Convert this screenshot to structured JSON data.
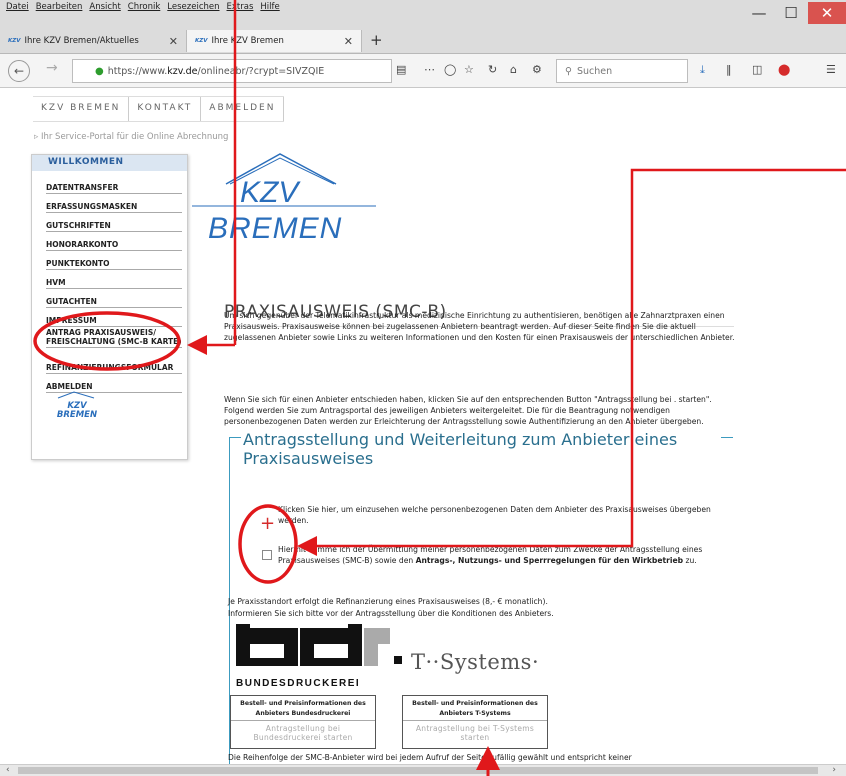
{
  "browser": {
    "menu": [
      "Datei",
      "Bearbeiten",
      "Ansicht",
      "Chronik",
      "Lesezeichen",
      "Extras",
      "Hilfe"
    ],
    "tabs": [
      {
        "favicon": "KZV",
        "title": "Ihre KZV Bremen/Aktuelles"
      },
      {
        "favicon": "KZV",
        "title": "Ihre KZV Bremen"
      }
    ],
    "url_prefix": "https://www.",
    "url_host": "kzv.de",
    "url_path": "/onlineabr/?crypt=SIVZQIE",
    "search_placeholder": "Suchen",
    "icons": [
      "back-icon",
      "forward-icon",
      "info-icon",
      "lock-icon",
      "reader-icon",
      "more-icon",
      "pocket-icon",
      "bookmark-star-icon",
      "reload-icon",
      "home-icon",
      "addon-icon",
      "search-icon",
      "download-icon",
      "library-icon",
      "sidebar-icon",
      "adblock-icon",
      "menu-icon"
    ]
  },
  "site": {
    "topnav": [
      "KZV BREMEN",
      "KONTAKT",
      "ABMELDEN"
    ],
    "breadcrumb": "Ihr Service-Portal für die Online Abrechnung",
    "logo_top": "KZV",
    "logo_bottom": "BREMEN"
  },
  "sidebar": {
    "heading": "WILLKOMMEN",
    "items": [
      {
        "label": "DATENTRANSFER"
      },
      {
        "label": "ERFASSUNGSMASKEN"
      },
      {
        "label": "GUTSCHRIFTEN"
      },
      {
        "label": "HONORARKONTO"
      },
      {
        "label": "PUNKTEKONTO"
      },
      {
        "label": "HVM"
      },
      {
        "label": "GUTACHTEN"
      },
      {
        "label": "IMPRESSUM"
      },
      {
        "label": "ANTRAG PRAXISAUSWEIS/ FREISCHALTUNG (SMC-B KARTE)"
      },
      {
        "label": "REFINANZIERUNGSFORMULAR"
      },
      {
        "label": "ABMELDEN"
      }
    ],
    "logo_top": "KZV",
    "logo_bottom": "BREMEN"
  },
  "main": {
    "title": "PRAXISAUSWEIS (SMC-B)",
    "para1": "Um sich gegenüber der Telematikinfrastruktur als medizinische Einrichtung zu authentisieren, benötigen alle Zahnarztpraxen einen Praxisausweis. Praxisausweise können bei zugelassenen Anbietern beantragt werden. Auf dieser Seite finden Sie die aktuell zugelassenen Anbieter sowie Links zu weiteren Informationen und den Kosten für einen Praxisausweis der unterschiedlichen Anbieter.",
    "para2": "Wenn Sie sich für einen Anbieter entschieden haben, klicken Sie auf den entsprechenden Button \"Antragsstellung bei . starten\". Folgend werden Sie zum Antragsportal des jeweiligen Anbieters weitergeleitet. Die für die Beantragung notwendigen personenbezogenen Daten werden zur Erleichterung der Antragsstellung sowie Authentifizierung an den Anbieter übergeben.",
    "box_title": "Antragsstellung und Weiterleitung zum Anbieter eines Praxisausweises",
    "expand_text": "Klicken Sie hier, um einzusehen welche personenbezogenen Daten dem Anbieter des Praxisausweises übergeben werden.",
    "consent_text": "Hiermit stimme ich der Übermittlung meiner personenbezogenen Daten zum Zwecke der Antragsstellung eines Praxisausweises (SMC-B) sowie den",
    "consent_bold": "Antrags-, Nutzungs- und Sperrregelungen für den Wirkbetrieb",
    "consent_end": "zu.",
    "refi_line1": "Je Praxisstandort erfolgt die Refinanzierung eines Praxisausweises (8,- € monatlich).",
    "refi_line2": "Informieren Sie sich bitte vor der Antragsstellung über die Konditionen des Anbieters.",
    "providers": [
      {
        "logo_text": "BUNDESDRUCKEREI",
        "info": "Bestell- und Preisinformationen des Anbieters Bundesdruckerei",
        "start": "Antragstellung bei Bundesdruckerei starten"
      },
      {
        "logo_text": "T··Systems·",
        "info": "Bestell- und Preisinformationen des Anbieters T-Systems",
        "start": "Antragstellung bei T-Systems starten"
      }
    ],
    "footnote": "Die Reihenfolge der SMC-B-Anbieter wird bei jedem Aufruf der Seite zufällig gewählt und entspricht keiner"
  },
  "colors": {
    "annotation": "#e0181b",
    "box_border": "#3c9bbf",
    "heading_blue": "#2a6f8e",
    "logo_blue": "#2a6ebb"
  }
}
